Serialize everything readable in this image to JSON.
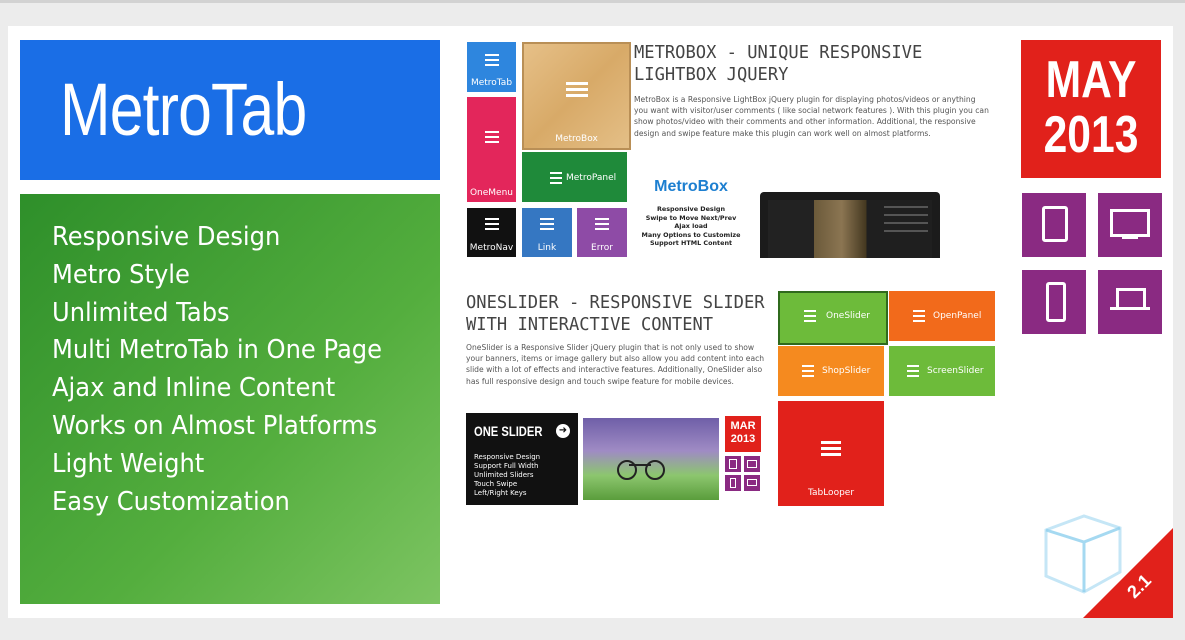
{
  "brand": {
    "title": "MetroTab"
  },
  "features": [
    "Responsive Design",
    "Metro Style",
    "Unlimited Tabs",
    "Multi MetroTab in One Page",
    "Ajax and Inline Content",
    "Works on Almost Platforms",
    "Light Weight",
    "Easy Customization"
  ],
  "release": {
    "month": "MAY",
    "year": "2013"
  },
  "version": "2.1",
  "metrobox": {
    "heading_line1": "METROBOX - UNIQUE RESPONSIVE",
    "heading_line2": "LIGHTBOX JQUERY",
    "description": "MetroBox is a Responsive LightBox jQuery plugin for displaying photos/videos or anything you want with visitor/user comments ( like social network features ). With this plugin you can show photos/video with their comments and other information. Additional, the responsive design and swipe feature make this plugin can work well on almost platforms.",
    "tiles": [
      "MetroTab",
      "MetroBox",
      "OneMenu",
      "MetroPanel",
      "MetroNav",
      "Link",
      "Error"
    ],
    "promo_title": "MetroBox",
    "promo_lines": [
      "Responsive Design",
      "Swipe to Move Next/Prev",
      "Ajax load",
      "Many Options to Customize",
      "Support HTML Content"
    ]
  },
  "oneslider": {
    "heading_line1": "ONESLIDER - RESPONSIVE SLIDER",
    "heading_line2": "WITH INTERACTIVE CONTENT",
    "description": "OneSlider is a Responsive Slider jQuery plugin that is not only used to show your banners, items or image gallery but also allow you add content into each slide with a lot of effects and interactive features. Additionally, OneSlider also has full responsive design and touch swipe feature for mobile devices.",
    "promo_title": "ONE SLIDER",
    "promo_lines": [
      "Responsive Design",
      "Support Full Width",
      "Unlimited Sliders",
      "Touch Swipe",
      "Left/Right Keys"
    ],
    "mini_date": {
      "month": "MAR",
      "year": "2013"
    },
    "tiles": [
      "OneSlider",
      "OpenPanel",
      "ShopSlider",
      "ScreenSlider",
      "TabLooper"
    ]
  },
  "colors": {
    "blue": "#1a6ee6",
    "green": "#4ba63b",
    "red": "#e1211b",
    "purple": "#8a2a82",
    "orange": "#f26a1b",
    "lime": "#6dbb3a"
  },
  "device_icons": [
    "tablet-icon",
    "monitor-icon",
    "phone-icon",
    "laptop-icon"
  ]
}
